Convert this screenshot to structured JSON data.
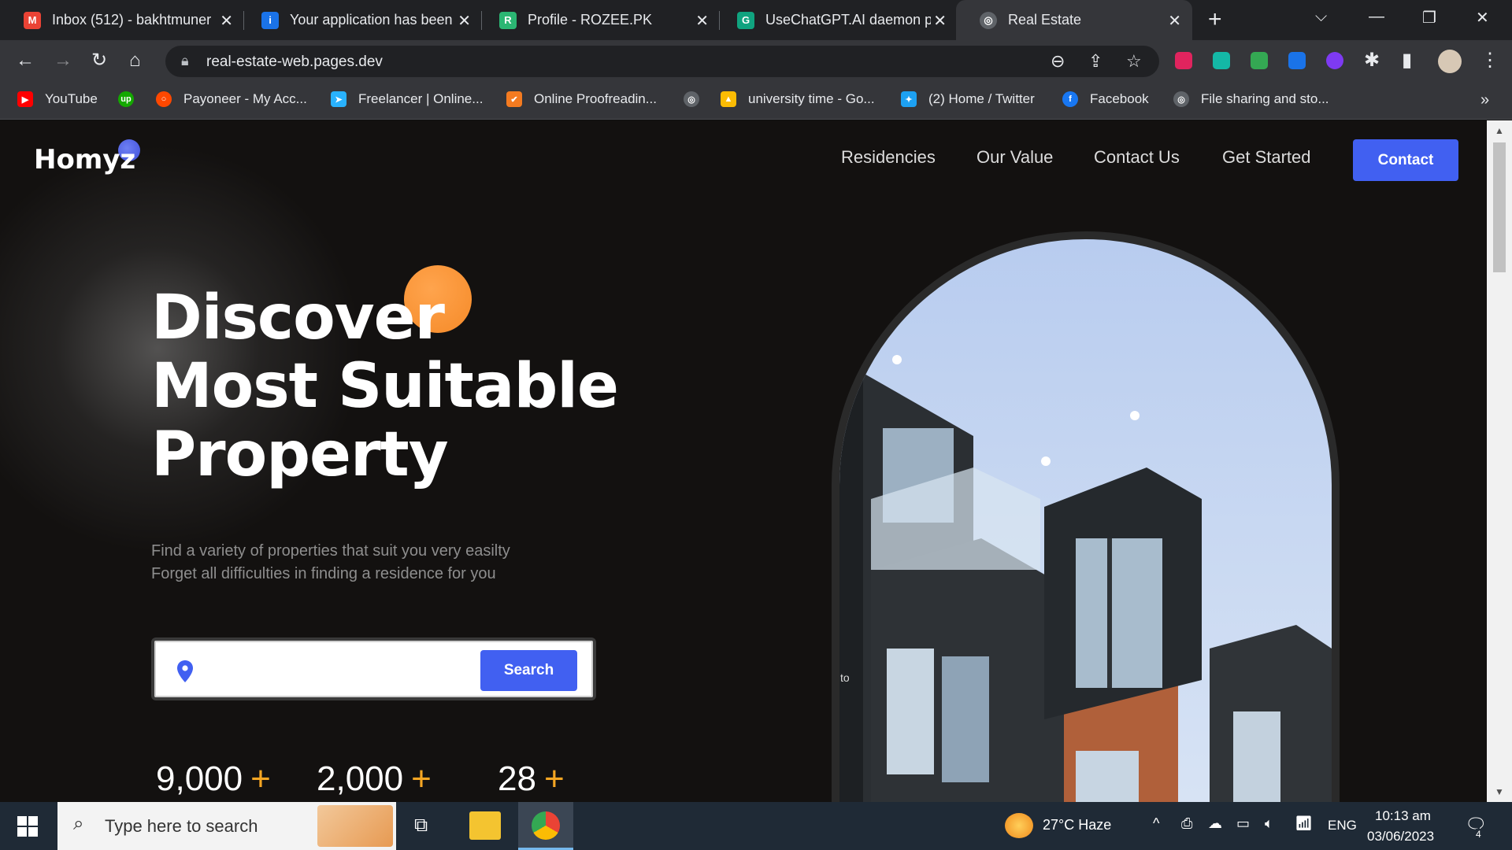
{
  "browser": {
    "tabs": [
      {
        "title": "Inbox (512) - bakhtmuner",
        "icon": "gmail-icon",
        "color": "#ea4335",
        "glyph": "M"
      },
      {
        "title": "Your application has been",
        "icon": "info-icon",
        "color": "#1a73e8",
        "glyph": "i"
      },
      {
        "title": "Profile - ROZEE.PK",
        "icon": "rozee-icon",
        "color": "#2bb673",
        "glyph": "R"
      },
      {
        "title": "UseChatGPT.AI daemon p",
        "icon": "chatgpt-icon",
        "color": "#10a37f",
        "glyph": "G"
      },
      {
        "title": "Real Estate",
        "icon": "globe-icon",
        "color": "#9aa0a6",
        "glyph": "◎"
      }
    ],
    "url": "real-estate-web.pages.dev",
    "bookmarks": [
      {
        "label": "YouTube",
        "icon": "youtube-icon",
        "color": "#ff0000",
        "glyph": "▶"
      },
      {
        "label": "",
        "icon": "upwork-icon",
        "color": "#14a800",
        "glyph": "up"
      },
      {
        "label": "Payoneer - My Acc...",
        "icon": "payoneer-icon",
        "color": "#ff4800",
        "glyph": "○"
      },
      {
        "label": "Freelancer | Online...",
        "icon": "freelancer-icon",
        "color": "#29b2fe",
        "glyph": "➤"
      },
      {
        "label": "Online Proofreadin...",
        "icon": "check-icon",
        "color": "#f47b20",
        "glyph": "✔"
      },
      {
        "label": "",
        "icon": "globe-icon",
        "color": "#9aa0a6",
        "glyph": "◎"
      },
      {
        "label": "university time - Go...",
        "icon": "google-drive-icon",
        "color": "#fbbc04",
        "glyph": "▲"
      },
      {
        "label": "(2) Home / Twitter",
        "icon": "twitter-icon",
        "color": "#1da1f2",
        "glyph": "✦"
      },
      {
        "label": "Facebook",
        "icon": "facebook-icon",
        "color": "#1877f2",
        "glyph": "f"
      },
      {
        "label": "File sharing and sto...",
        "icon": "globe-icon",
        "color": "#9aa0a6",
        "glyph": "◎"
      }
    ]
  },
  "site": {
    "logo": "Homyz",
    "nav": [
      "Residencies",
      "Our Value",
      "Contact Us",
      "Get Started"
    ],
    "contact_button": "Contact",
    "headline": [
      "Discover",
      "Most Suitable",
      "Property"
    ],
    "subtitle": [
      "Find a variety of properties that suit you very easilty",
      "Forget all difficulties in finding a residence for you"
    ],
    "search": {
      "placeholder": "",
      "button": "Search"
    },
    "stats": [
      "9,000",
      "2,000",
      "28"
    ],
    "stat_suffix": "+",
    "image_caption": "to",
    "colors": {
      "accent": "#4160f1",
      "orange": "#f58a28",
      "background": "#131110"
    }
  },
  "taskbar": {
    "search_placeholder": "Type here to search",
    "weather": "27°C  Haze",
    "language": "ENG",
    "time": "10:13 am",
    "date": "03/06/2023",
    "notifications": "4"
  }
}
